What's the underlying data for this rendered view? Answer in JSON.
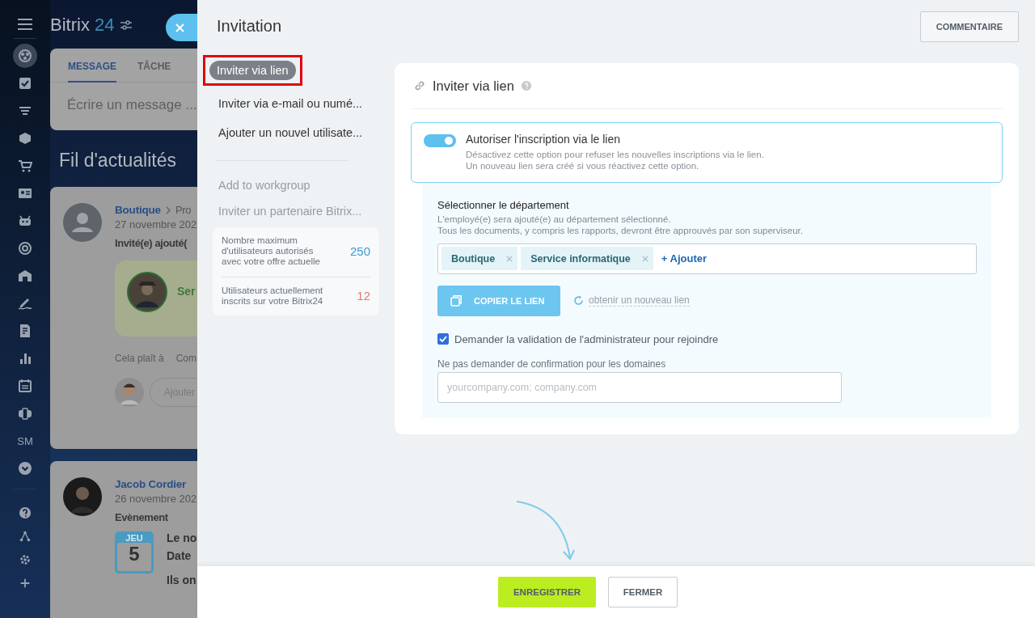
{
  "app_sidebar": {
    "badge": "SM"
  },
  "header": {
    "title": "Bitrix",
    "title_number": "24"
  },
  "composer": {
    "tabs": [
      {
        "label": "MESSAGE",
        "selected": true
      },
      {
        "label": "TÂCHE",
        "selected": false
      }
    ],
    "placeholder": "Écrire un message ..."
  },
  "feed": {
    "title": "Fil d'actualités",
    "posts": [
      {
        "kind": "invite",
        "author": "Boutique",
        "breadcrumb": "Pro",
        "date": "27 novembre 202",
        "headline": "Invité(e) ajouté(",
        "guest_name": "Ser",
        "actions": [
          "Cela plaît à",
          "Com"
        ],
        "comment_placeholder": "Ajouter"
      },
      {
        "kind": "event",
        "author": "Jacob Cordier",
        "date": "26 novembre 202",
        "headline": "Evènement",
        "calendar": {
          "weekday": "JEU",
          "day": "5"
        },
        "lines": [
          "Le no",
          "Date",
          "Ils on"
        ]
      }
    ]
  },
  "slider": {
    "title": "Invitation",
    "comment_button": "COMMENTAIRE",
    "nav": [
      {
        "label": "Inviter via lien",
        "selected": true,
        "highlighted": true
      },
      {
        "label": "Inviter via e-mail ou numé...",
        "selected": false,
        "highlighted": false
      },
      {
        "label": "Ajouter un nouvel utilisate...",
        "selected": false,
        "highlighted": false
      }
    ],
    "nav_secondary": [
      "Add to workgroup",
      "Inviter un partenaire Bitrix..."
    ],
    "stats": [
      {
        "label": "Nombre maximum d'utilisateurs autorisés avec votre offre actuelle",
        "value": "250",
        "color": "#3a9bd9"
      },
      {
        "label": "Utilisateurs actuellement inscrits sur votre Bitrix24",
        "value": "12",
        "color": "#e8776a"
      }
    ],
    "card": {
      "title": "Inviter via lien",
      "toggle": {
        "label": "Autoriser l'inscription via le lien",
        "on": true,
        "description": [
          "Désactivez cette option pour refuser les nouvelles inscriptions via le lien.",
          "Un nouveau lien sera créé si vous réactivez cette option."
        ]
      },
      "department": {
        "label": "Sélectionner le département",
        "hint": [
          "L'employé(e) sera ajouté(e) au département sélectionné.",
          "Tous les documents, y compris les rapports, devront être approuvés par son superviseur."
        ],
        "tags": [
          "Boutique",
          "Service informatique"
        ],
        "add": "+ Ajouter"
      },
      "copy_button": "COPIER LE LIEN",
      "regenerate_link": "obtenir un nouveau lien",
      "approval": {
        "label": "Demander la validation de l'administrateur pour rejoindre",
        "checked": true
      },
      "domains": {
        "label": "Ne pas demander de confirmation pour les domaines",
        "placeholder": "yourcompany.com; company.com"
      }
    }
  },
  "footer": {
    "save": "ENREGISTRER",
    "close": "FERMER"
  }
}
